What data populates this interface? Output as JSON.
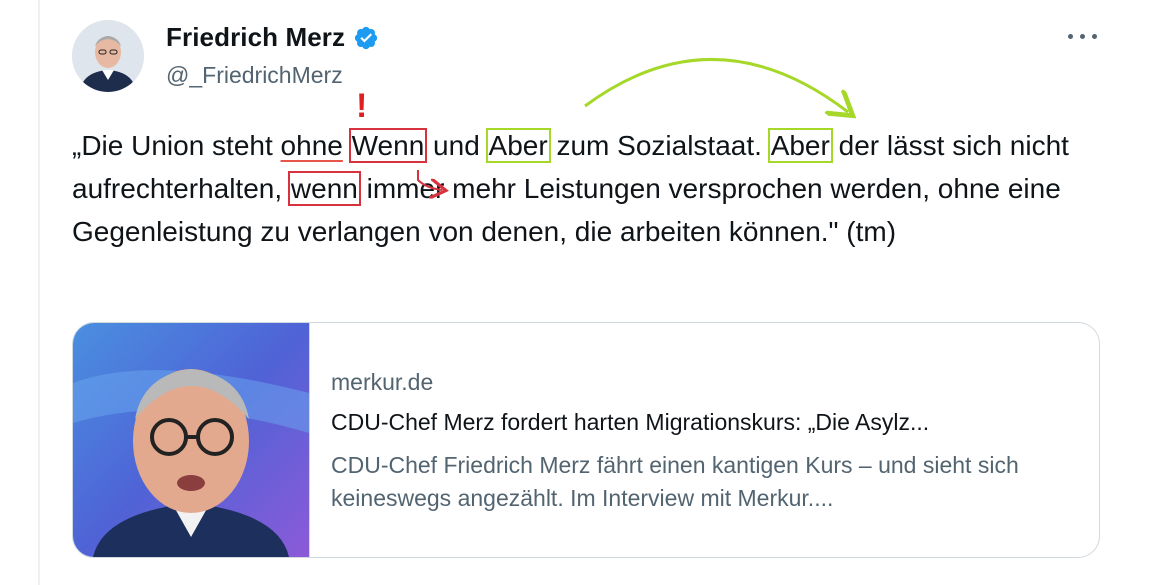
{
  "author": {
    "display_name": "Friedrich Merz",
    "handle": "@_FriedrichMerz",
    "verified_icon": "verified-badge-icon",
    "verified_color": "#1d9bf0"
  },
  "menu": {
    "icon": "more-horizontal-icon"
  },
  "tweet": {
    "text_parts": [
      "„Die Union steht ",
      "ohne",
      " ",
      "Wenn",
      " und ",
      "Aber",
      " zum Sozialstaat. ",
      "Aber",
      " der lässt sich nicht aufrechterhalten, ",
      "wenn",
      " immer mehr Leistungen versprochen werden, ohne eine Gegenleistung zu verlangen von denen, die arbeiten können.\" (tm)"
    ]
  },
  "annotations": {
    "exclamation_mark": "!",
    "red_color": "#d6333f",
    "green_color": "#a6d82a"
  },
  "link_card": {
    "domain": "merkur.de",
    "title": "CDU-Chef Merz fordert harten Migrationskurs: „Die Asylz...",
    "description": "CDU-Chef Friedrich Merz fährt einen kantigen Kurs – und sieht sich keineswegs angezählt. Im Interview mit Merkur...."
  }
}
